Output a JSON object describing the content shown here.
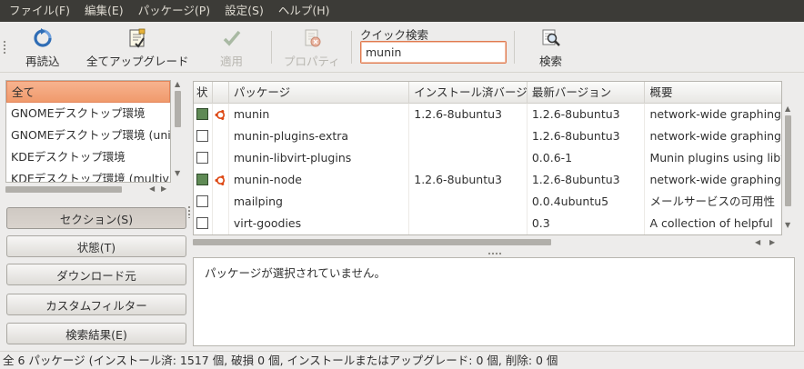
{
  "menubar": {
    "items": [
      "ファイル(F)",
      "編集(E)",
      "パッケージ(P)",
      "設定(S)",
      "ヘルプ(H)"
    ]
  },
  "toolbar": {
    "reload_label": "再読込",
    "upgrade_all_label": "全てアップグレード",
    "apply_label": "適用",
    "properties_label": "プロパティ",
    "quick_search_label": "クイック検索",
    "quick_search_value": "munin",
    "search_label": "検索"
  },
  "filter_list": {
    "items": [
      "全て",
      "GNOMEデスクトップ環境",
      "GNOMEデスクトップ環境 (uni",
      "KDEデスクトップ環境",
      "KDEデスクトップ環境 (multiv"
    ],
    "selected_index": 0
  },
  "side_buttons": {
    "sections": "セクション(S)",
    "status": "状態(T)",
    "origin": "ダウンロード元",
    "custom_filters": "カスタムフィルター",
    "search_results": "検索結果(E)"
  },
  "package_table": {
    "columns": [
      "状",
      "",
      "パッケージ",
      "インストール済バージョン",
      "最新バージョン",
      "概要"
    ],
    "rows": [
      {
        "installed": true,
        "ubuntu": true,
        "name": "munin",
        "installed_version": "1.2.6-8ubuntu3",
        "latest_version": "1.2.6-8ubuntu3",
        "summary": "network-wide graphing framework"
      },
      {
        "installed": false,
        "ubuntu": false,
        "name": "munin-plugins-extra",
        "installed_version": "",
        "latest_version": "1.2.6-8ubuntu3",
        "summary": "network-wide graphing framework"
      },
      {
        "installed": false,
        "ubuntu": false,
        "name": "munin-libvirt-plugins",
        "installed_version": "",
        "latest_version": "0.0.6-1",
        "summary": "Munin plugins using libvirt"
      },
      {
        "installed": true,
        "ubuntu": true,
        "name": "munin-node",
        "installed_version": "1.2.6-8ubuntu3",
        "latest_version": "1.2.6-8ubuntu3",
        "summary": "network-wide graphing framework"
      },
      {
        "installed": false,
        "ubuntu": false,
        "name": "mailping",
        "installed_version": "",
        "latest_version": "0.0.4ubuntu5",
        "summary": "メールサービスの可用性"
      },
      {
        "installed": false,
        "ubuntu": false,
        "name": "virt-goodies",
        "installed_version": "",
        "latest_version": "0.3",
        "summary": "A collection of helpful"
      }
    ]
  },
  "detail_panel": {
    "text": "パッケージが選択されていません。"
  },
  "statusbar": {
    "text": "全 6 パッケージ (インストール済: 1517 個, 破損 0 個, インストールまたはアップグレード: 0 個, 削除: 0 個"
  },
  "colors": {
    "menubar_bg": "#3c3b37",
    "selection": "#f09a6c",
    "installed_checkbox": "#5f8a55",
    "ubuntu_logo": "#dd4814"
  }
}
